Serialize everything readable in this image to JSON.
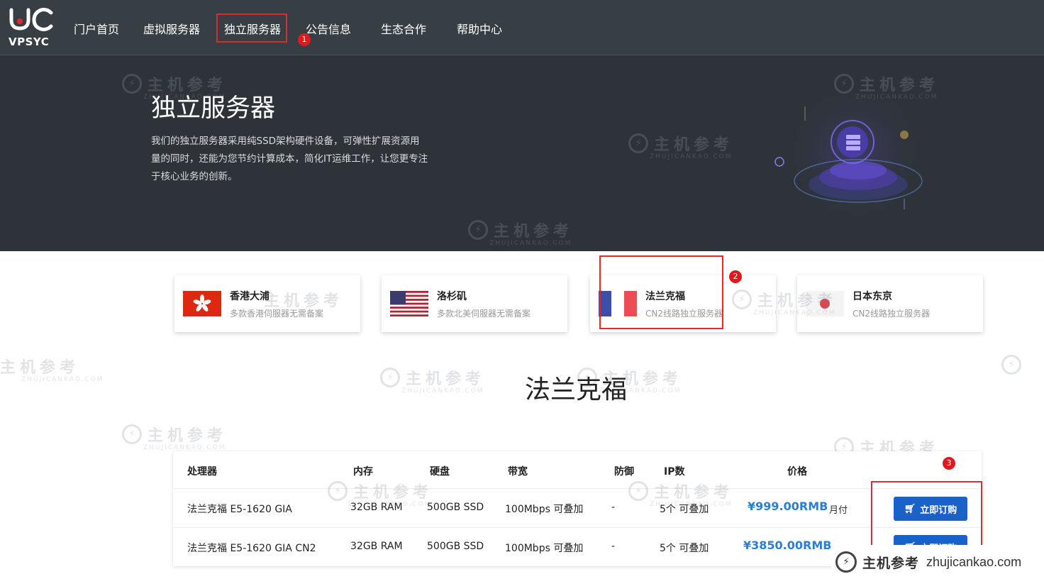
{
  "brand": {
    "logo_text": "VPSYC"
  },
  "nav": {
    "items": [
      {
        "label": "门户首页"
      },
      {
        "label": "虚拟服务器"
      },
      {
        "label": "独立服务器"
      },
      {
        "label": "公告信息"
      },
      {
        "label": "生态合作"
      },
      {
        "label": "帮助中心"
      }
    ]
  },
  "annotations": {
    "badge1": "1",
    "badge2": "2",
    "badge3": "3"
  },
  "hero": {
    "title": "独立服务器",
    "description": "我们的独立服务器采用纯SSD架构硬件设备，可弹性扩展资源用量的同时，还能为您节约计算成本，简化IT运维工作，让您更专注于核心业务的创新。"
  },
  "locations": [
    {
      "name": "香港大浦",
      "subtitle": "多款香港伺服器无需备案",
      "flag": "hong-kong-flag"
    },
    {
      "name": "洛杉矶",
      "subtitle": "多款北美伺服器无需备案",
      "flag": "usa-flag"
    },
    {
      "name": "法兰克福",
      "subtitle": "CN2线路独立服务器",
      "flag": "france-flag"
    },
    {
      "name": "日本东京",
      "subtitle": "CN2线路独立服务器",
      "flag": "japan-flag"
    }
  ],
  "section": {
    "title": "法兰克福"
  },
  "table": {
    "headers": {
      "cpu": "处理器",
      "ram": "内存",
      "disk": "硬盘",
      "bandwidth": "带宽",
      "defense": "防御",
      "ip": "IP数",
      "price": "价格"
    },
    "rows": [
      {
        "cpu": "法兰克福 E5-1620 GIA",
        "ram": "32GB RAM",
        "disk": "500GB SSD",
        "bandwidth": "100Mbps 可叠加",
        "defense": "-",
        "ip": "5个 可叠加",
        "price": "¥999.00RMB",
        "period": "月付",
        "button": "立即订购"
      },
      {
        "cpu": "法兰克福 E5-1620 GIA CN2",
        "ram": "32GB RAM",
        "disk": "500GB SSD",
        "bandwidth": "100Mbps 可叠加",
        "defense": "-",
        "ip": "5个 可叠加",
        "price": "¥3850.00RMB",
        "period": "",
        "button": "立即订购"
      }
    ]
  },
  "watermark": {
    "cn": "主机参考",
    "en": "ZHUJICANKAO.COM",
    "footer_name": "主机参考",
    "footer_url": "zhujicankao.com"
  },
  "colors": {
    "accent": "#1a62c9",
    "price": "#2a7fd4",
    "highlight": "#e0282d",
    "hero_bg": "#2d3338"
  }
}
